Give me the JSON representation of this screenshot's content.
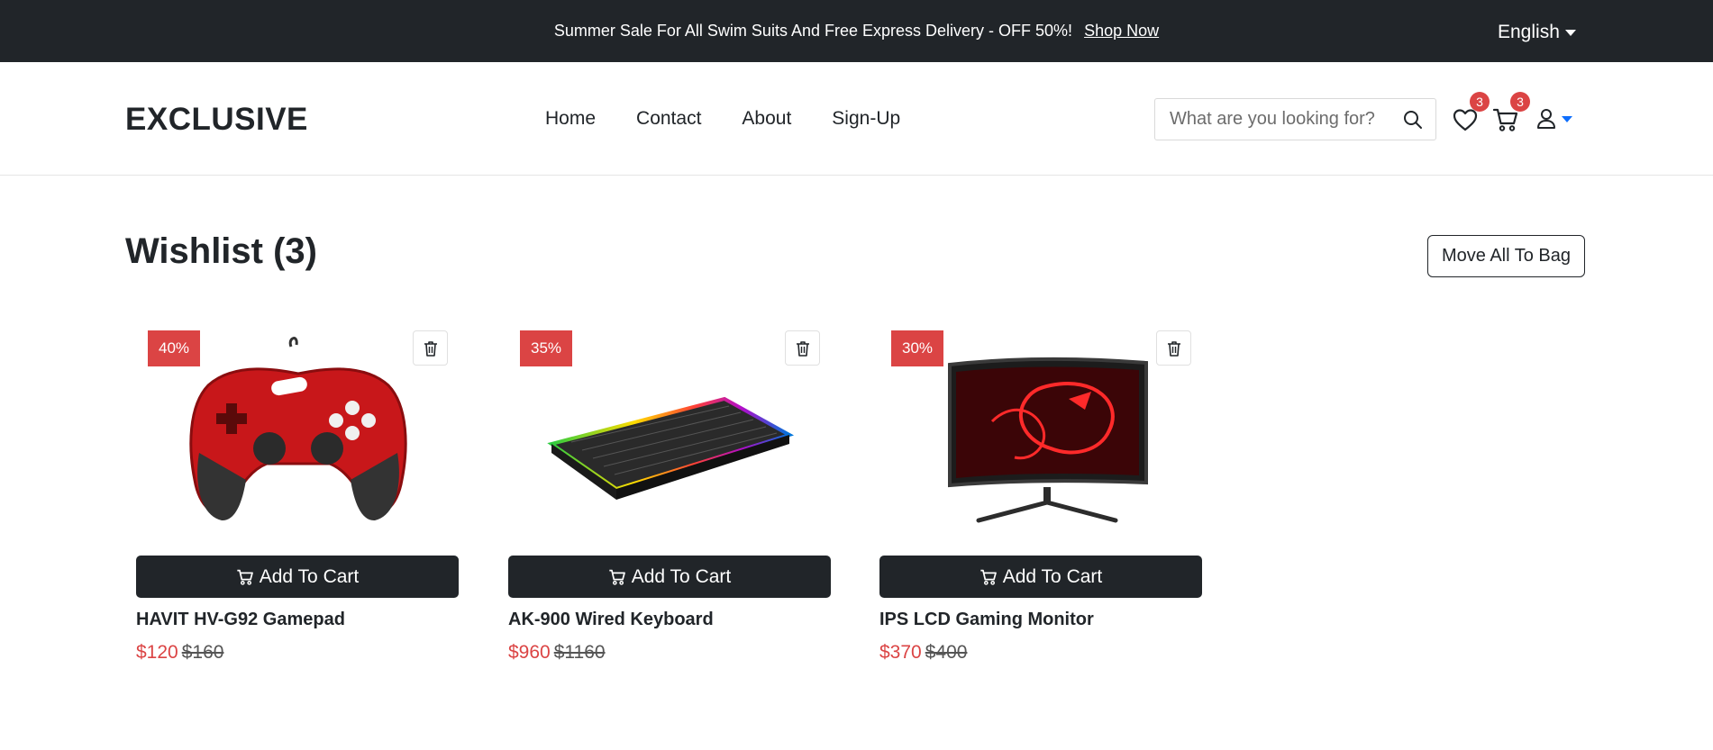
{
  "colors": {
    "topbar_bg": "#212529",
    "accent": "#db4444",
    "button_bg": "#212529",
    "user_caret": "#0d6efd"
  },
  "topbar": {
    "promo_text": "Summer Sale For All Swim Suits And Free Express Delivery - OFF 50%!",
    "promo_link": "Shop Now",
    "language": "English"
  },
  "header": {
    "logo": "EXCLUSIVE",
    "nav": [
      "Home",
      "Contact",
      "About",
      "Sign-Up"
    ],
    "search_placeholder": "What are you looking for?",
    "wishlist_count": "3",
    "cart_count": "3",
    "icons": [
      "search-icon",
      "heart-icon",
      "cart-icon",
      "user-icon"
    ]
  },
  "wishlist": {
    "title": "Wishlist (3)",
    "move_all_label": "Move All To Bag",
    "products": [
      {
        "discount": "40%",
        "name": "HAVIT HV-G92 Gamepad",
        "price": "$120",
        "old_price": "$160",
        "image": "gamepad",
        "button": "Add To Cart"
      },
      {
        "discount": "35%",
        "name": "AK-900 Wired Keyboard",
        "price": "$960",
        "old_price": "$1160",
        "image": "keyboard",
        "button": "Add To Cart"
      },
      {
        "discount": "30%",
        "name": "IPS LCD Gaming Monitor",
        "price": "$370",
        "old_price": "$400",
        "image": "monitor",
        "button": "Add To Cart"
      }
    ]
  }
}
